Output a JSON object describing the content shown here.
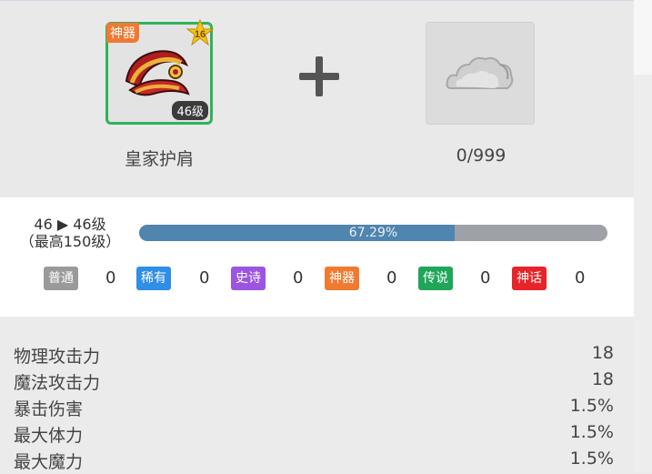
{
  "item": {
    "tag": "神器",
    "star_level": "16",
    "level_badge": "46级",
    "name": "皇家护肩"
  },
  "material": {
    "icon": "cloud-material-icon",
    "count": "0/999"
  },
  "upgrade": {
    "level_line": "46 ▶ 46级",
    "max_line": "（最高150级）",
    "progress_text": "67.29%",
    "progress_value": 0.6729
  },
  "rarities": [
    {
      "label": "普通",
      "count": "0",
      "color": "#9a9a9a"
    },
    {
      "label": "稀有",
      "count": "0",
      "color": "#2f8ee6"
    },
    {
      "label": "史诗",
      "count": "0",
      "color": "#9b55e0"
    },
    {
      "label": "神器",
      "count": "0",
      "color": "#f07a30"
    },
    {
      "label": "传说",
      "count": "0",
      "color": "#1fa65a"
    },
    {
      "label": "神话",
      "count": "0",
      "color": "#e6242a"
    }
  ],
  "stats": [
    {
      "label": "物理攻击力",
      "value": "18"
    },
    {
      "label": "魔法攻击力",
      "value": "18"
    },
    {
      "label": "暴击伤害",
      "value": "1.5%"
    },
    {
      "label": "最大体力",
      "value": "1.5%"
    },
    {
      "label": "最大魔力",
      "value": "1.5%"
    }
  ],
  "colors": {
    "frame": "#2db35a",
    "progress": "#4f85ae",
    "track": "#9ea1a8"
  }
}
